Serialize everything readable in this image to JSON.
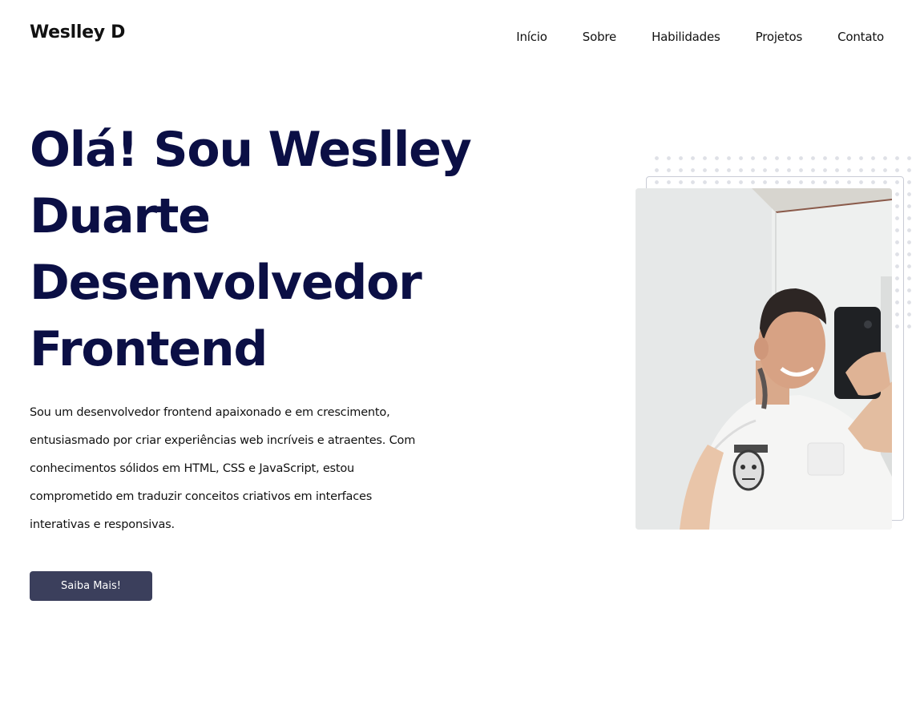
{
  "header": {
    "logo": "Weslley D",
    "nav": [
      "Início",
      "Sobre",
      "Habilidades",
      "Projetos",
      "Contato"
    ]
  },
  "hero": {
    "title_lines": [
      "Olá! Sou Weslley",
      "Duarte",
      "Desenvolvedor",
      "Frontend"
    ],
    "description_lines": [
      "Sou um desenvolvedor frontend apaixonado e em crescimento,",
      "entusiasmado por criar experiências web incríveis e atraentes. Com",
      "conhecimentos sólidos em HTML, CSS e JavaScript, estou",
      "comprometido em traduzir conceitos criativos em interfaces",
      "interativas e responsivas."
    ],
    "button_label": "Saiba Mais!"
  },
  "colors": {
    "title": "#0b0f45",
    "button_bg": "#3b3f5c",
    "text": "#111111"
  },
  "icons": {
    "profile_photo": "person-selfie-photo"
  }
}
